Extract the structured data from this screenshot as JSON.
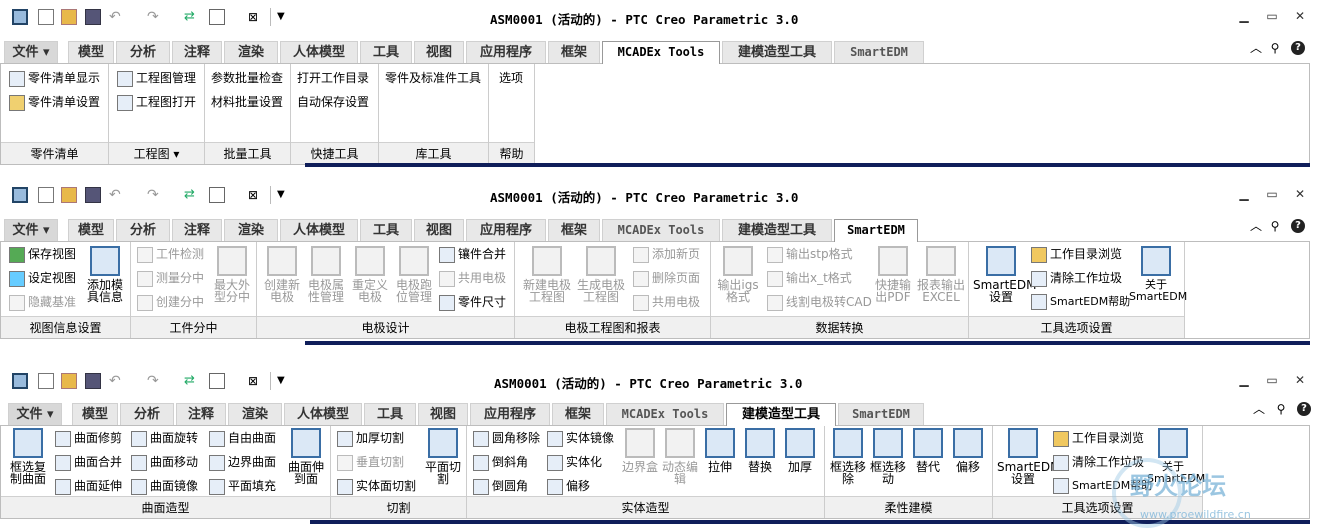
{
  "title": "ASM0001 (活动的) - PTC Creo Parametric 3.0",
  "tabs": [
    "文件",
    "模型",
    "分析",
    "注释",
    "渲染",
    "人体模型",
    "工具",
    "视图",
    "应用程序",
    "框架",
    "MCADEx Tools",
    "建模造型工具",
    "SmartEDM"
  ],
  "w1": {
    "g1": {
      "label": "零件清单",
      "items": [
        "零件清单显示",
        "零件清单设置"
      ]
    },
    "g2": {
      "label": "工程图",
      "items": [
        "工程图管理",
        "工程图打开"
      ]
    },
    "g3": {
      "label": "批量工具",
      "items": [
        "参数批量检查",
        "材料批量设置"
      ]
    },
    "g4": {
      "label": "快捷工具",
      "items": [
        "打开工作目录",
        "自动保存设置"
      ]
    },
    "g5": {
      "label": "库工具",
      "items": [
        "零件及标准件工具"
      ]
    },
    "g6": {
      "label": "帮助",
      "items": [
        "选项"
      ]
    }
  },
  "w2": {
    "g1": {
      "label": "视图信息设置",
      "items": [
        "保存视图",
        "设定视图",
        "隐藏基准"
      ],
      "big": "添加模具信息"
    },
    "g2": {
      "label": "工件分中",
      "items": [
        "工件检测",
        "测量分中",
        "创建分中"
      ],
      "big": "最大外型分中"
    },
    "g3": {
      "label": "电极设计",
      "big": [
        "创建新电极",
        "电极属性管理",
        "重定义电极",
        "电极跑位管理"
      ],
      "items": [
        "镶件合并",
        "共用电极",
        "零件尺寸"
      ]
    },
    "g4": {
      "label": "电极工程图和报表",
      "big": [
        "新建电极工程图",
        "生成电极工程图"
      ],
      "items": [
        "添加新页",
        "删除页面",
        "共用电极"
      ]
    },
    "g5": {
      "label": "数据转换",
      "big": [
        "输出igs格式",
        "快捷输出PDF",
        "报表输出EXCEL"
      ],
      "items": [
        "输出stp格式",
        "输出x_t格式",
        "线割电极转CAD"
      ]
    },
    "g6": {
      "label": "工具选项设置",
      "big": [
        "SmartEDM设置",
        "关于SmartEDM"
      ],
      "items": [
        "工作目录浏览",
        "清除工作垃圾",
        "SmartEDM帮助"
      ]
    }
  },
  "w3": {
    "g1": {
      "label": "曲面造型",
      "big": [
        "框选复制曲面",
        "曲面伸到面"
      ],
      "items": [
        "曲面修剪",
        "曲面合并",
        "曲面延伸",
        "曲面旋转",
        "曲面移动",
        "曲面镜像",
        "自由曲面",
        "边界曲面",
        "平面填充"
      ]
    },
    "g2": {
      "label": "切割",
      "items": [
        "加厚切割",
        "垂直切割",
        "实体面切割"
      ],
      "big": "平面切割"
    },
    "g3": {
      "label": "实体造型",
      "items": [
        "圆角移除",
        "倒斜角",
        "倒圆角",
        "实体镜像",
        "实体化",
        "偏移"
      ],
      "big": [
        "边界盒",
        "动态编辑",
        "拉伸",
        "替换",
        "加厚"
      ]
    },
    "g4": {
      "label": "柔性建模",
      "big": [
        "框选移除",
        "框选移动",
        "替代",
        "偏移"
      ]
    },
    "g5": {
      "label": "工具选项设置",
      "big": [
        "SmartEDM设置",
        "关于SmartEDM"
      ],
      "items": [
        "工作目录浏览",
        "清除工作垃圾",
        "SmartEDM帮助"
      ]
    }
  },
  "watermark": "野火论坛",
  "watermark_url": "www.proewildfire.cn",
  "colors": {
    "accent": "#0f1e5a",
    "icon": "#3a6ea5"
  }
}
